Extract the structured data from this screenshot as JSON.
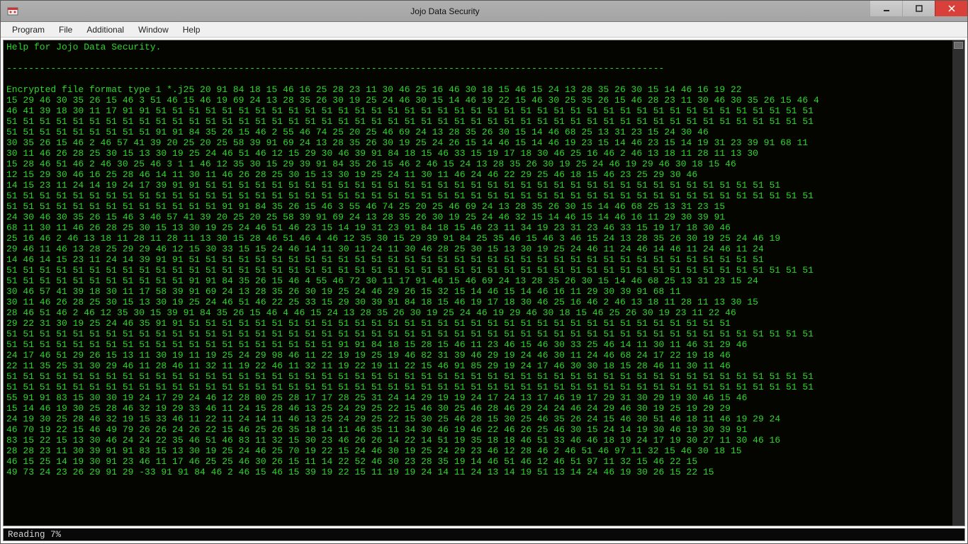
{
  "window": {
    "title": "Jojo Data Security"
  },
  "menu": {
    "items": [
      "Program",
      "File",
      "Additional",
      "Window",
      "Help"
    ]
  },
  "console": {
    "header": "Help for Jojo Data Security.",
    "blank": "",
    "divider": "-----------------------------------------------------------------------------------------------------------------------",
    "intro": "Encrypted file format type 1 *.j25 20 91 84 18 15 46 16 25 28 23 11 30 46 25 16 46 30 18 15 46 15 24 13 28 35 26 30 15 14 46 16 19 22",
    "lines": [
      "15 29 46 30 35 26 15 46 3 51 46 15 46 19 69 24 13 28 35 26 30 19 25 24 46 30 15 14 46 19 22 15 46 30 25 35 26 15 46 28 23 11 30 46 30 35 26 15 46 4",
      "46 41 39 18 30 11 17 91 91 51 51 51 51 51 51 51 51 51 51 51 51 51 51 51 51 51 51 51 51 51 51 51 51 51 51 51 51 51 51 51 51 51 51 51 51 51 51 51 51",
      "51 51 51 51 51 51 51 51 51 51 51 51 51 51 51 51 51 51 51 51 51 51 51 51 51 51 51 51 51 51 51 51 51 51 51 51 51 51 51 51 51 51 51 51 51 51 51 51 51",
      "51 51 51 51 51 51 51 51 51 91 91 84 35 26 15 46 2 55 46 74 25 20 25 46 69 24 13 28 35 26 30 15 14 46 68 25 13 31 23 15 24 30 46",
      "30 35 26 15 46 2 46 57 41 39 20 25 20 25 58 39 91 69 24 13 28 35 26 30 19 25 24 26 15 14 46 15 14 46 19 23 15 14 46 23 15 14 19 31 23 39 91 68 11",
      "30 11 46 26 28 25 30 15 13 30 19 25 24 46 51 46 12 15 29 30 46 39 91 84 18 15 46 33 15 19 17 18 30 46 25 16 46 2 46 13 18 11 28 11 13 30",
      "15 28 46 51 46 2 46 30 25 46 3 1 1 46 12 35 30 15 29 39 91 84 35 26 15 46 2 46 15 24 13 28 35 26 30 19 25 24 46 19 29 46 30 18 15 46",
      "12 15 29 30 46 16 25 28 46 14 11 30 11 46 26 28 25 30 15 13 30 19 25 24 11 30 11 46 24 46 22 29 25 46 18 15 46 23 25 29 30 46",
      "14 15 23 11 24 14 19 24 17 39 91 91 51 51 51 51 51 51 51 51 51 51 51 51 51 51 51 51 51 51 51 51 51 51 51 51 51 51 51 51 51 51 51 51 51 51 51",
      "51 51 51 51 51 51 51 51 51 51 51 51 51 51 51 51 51 51 51 51 51 51 51 51 51 51 51 51 51 51 51 51 51 51 51 51 51 51 51 51 51 51 51 51 51 51 51 51 51",
      "51 51 51 51 51 51 51 51 51 51 51 51 51 91 91 84 35 26 15 46 3 55 46 74 25 20 25 46 69 24 13 28 35 26 30 15 14 46 68 25 13 31 23 15",
      "24 30 46 30 35 26 15 46 3 46 57 41 39 20 25 20 25 58 39 91 69 24 13 28 35 26 30 19 25 24 46 32 15 14 46 15 14 46 16 11 29 30 39 91",
      "68 11 30 11 46 26 28 25 30 15 13 30 19 25 24 46 51 46 23 15 14 19 31 23 91 84 18 15 46 23 11 34 19 23 31 23 46 33 15 19 17 18 30 46",
      "25 16 46 2 46 13 18 11 28 11 28 11 13 30 15 28 46 51 46 4 46 12 35 30 15 29 39 91 84 25 35 46 15 46 3 46 15 24 13 28 35 26 30 19 25 24 46 19",
      "29 46 11 46 13 28 25 29 29 46 12 15 30 33 15 15 24 46 14 11 30 11 24 11 30 46 28 25 30 15 13 30 19 25 24 46 11 24 46 14 46 11 24 46 11 24",
      "14 46 14 15 23 11 24 14 39 91 91 51 51 51 51 51 51 51 51 51 51 51 51 51 51 51 51 51 51 51 51 51 51 51 51 51 51 51 51 51 51 51 51 51 51 51",
      "51 51 51 51 51 51 51 51 51 51 51 51 51 51 51 51 51 51 51 51 51 51 51 51 51 51 51 51 51 51 51 51 51 51 51 51 51 51 51 51 51 51 51 51 51 51 51 51 51",
      "51 51 51 51 51 51 51 51 51 51 51 91 91 84 35 26 15 46 4 55 46 72 30 11 17 91 46 15 46 69 24 13 28 35 26 30 15 14 46 68 25 13 31 23 15 24",
      "30 46 57 41 39 18 30 11 17 58 39 91 69 24 13 28 35 26 30 19 25 24 46 29 26 15 32 15 14 46 15 14 46 16 11 29 30 39 91 68 11",
      "30 11 46 26 28 25 30 15 13 30 19 25 24 46 51 46 22 25 33 15 29 30 39 91 84 18 15 46 19 17 18 30 46 25 16 46 2 46 13 18 11 28 11 13 30 15",
      "28 46 51 46 2 46 12 35 30 15 39 91 84 35 26 15 46 4 46 15 24 13 28 35 26 30 19 25 24 46 19 29 46 30 18 15 46 25 26 30 19 23 11 22 46",
      "29 22 31 30 19 25 24 46 35 91 91 51 51 51 51 51 51 51 51 51 51 51 51 51 51 51 51 51 51 51 51 51 51 51 51 51 51 51 51 51 51 51 51 51",
      "51 51 51 51 51 51 51 51 51 51 51 51 51 51 51 51 51 51 51 51 51 51 51 51 51 51 51 51 51 51 51 51 51 51 51 51 51 51 51 51 51 51 51 51 51 51 51 51 51",
      "51 51 51 51 51 51 51 51 51 51 51 51 51 51 51 51 51 51 51 51 91 91 84 18 15 28 15 46 11 23 46 15 46 30 33 25 46 14 11 30 11 46 31 29 46",
      "24 17 46 51 29 26 15 13 11 30 19 11 19 25 24 29 98 46 11 22 19 19 25 19 46 82 31 39 46 29 19 24 46 30 11 24 46 68 24 17 22 19 18 46",
      "22 11 35 25 31 30 29 46 11 28 46 11 32 11 19 22 46 11 32 11 19 22 19 11 22 15 46 91 85 29 19 24 17 46 30 30 18 15 28 46 11 30 11 46",
      "51 51 51 51 51 51 51 51 51 51 51 51 51 51 51 51 51 51 51 51 51 51 51 51 51 51 51 51 51 51 51 51 51 51 51 51 51 51 51 51 51 51 51 51 51 51 51 51 51",
      "51 51 51 51 51 51 51 51 51 51 51 51 51 51 51 51 51 51 51 51 51 51 51 51 51 51 51 51 51 51 51 51 51 51 51 51 51 51 51 51 51 51 51 51 51 51 51 51 51",
      "55 91 91 83 15 30 30 19 24 17 29 24 46 12 28 80 25 28 17 17 28 25 31 24 14 29 19 19 24 17 24 13 17 46 19 17 29 31 30 29 19 30 46 15 46",
      "15 14 46 19 30 25 28 46 32 19 29 33 46 11 24 15 28 46 13 25 24 29 25 22 15 46 30 25 46 28 46 29 24 24 46 24 29 46 30 19 25 19 29 29",
      "24 19 30 25 28 46 32 19 15 33 46 11 22 11 24 14 11 46 13 25 24 29 25 22 15 30 25 46 28 15 30 25 46 35 26 24 15 46 30 51 46 18 11 46 19 29 24",
      "46 70 19 22 15 46 49 79 26 26 24 26 22 15 46 25 26 35 18 14 11 46 35 11 34 30 46 19 46 22 46 26 25 46 30 15 24 14 19 30 46 19 30 39 91",
      "83 15 22 15 13 30 46 24 24 22 35 46 51 46 83 11 32 15 30 23 46 26 26 14 22 14 51 19 35 18 18 46 51 33 46 46 18 19 24 17 19 30 27 11 30 46 16",
      "28 28 23 11 30 39 91 91 83 15 13 30 19 25 24 46 25 70 19 22 15 24 46 30 19 25 24 29 23 46 12 28 46 2 46 51 46 97 11 32 15 46 30 18 15",
      "46 15 25 14 19 30 91 23 46 11 17 46 25 25 46 30 26 15 11 14 22 52 46 30 23 28 35 19 14 46 51 46 12 46 51 97 11 32 15 46 22 15",
      "49 73 24 23 26 29 91 29 -33 91 91 84 46 2 46 15 46 15 39 19 22 15 11 19 19 24 14 11 24 13 14 19 51 13 14 24 46 19 30 26 15 22 15"
    ]
  },
  "status": {
    "text": "Reading 7%"
  }
}
